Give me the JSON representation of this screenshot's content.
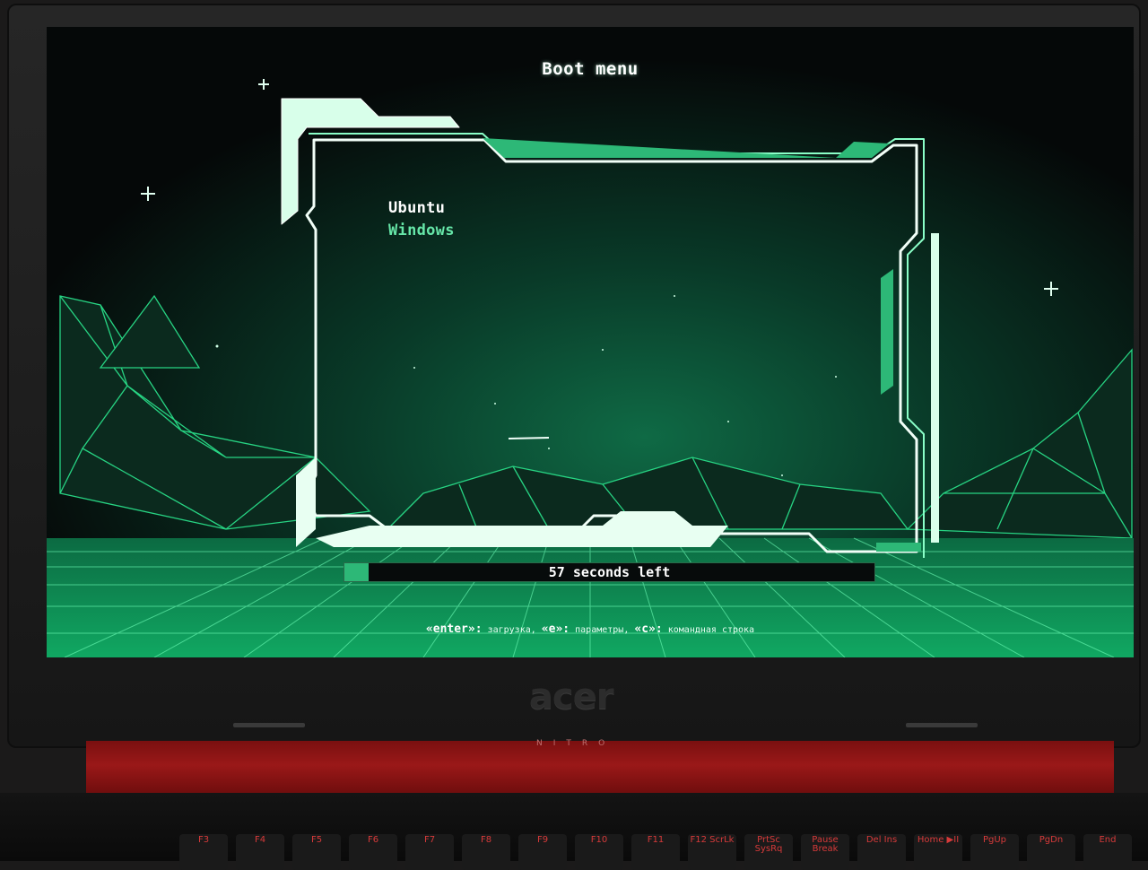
{
  "boot_screen": {
    "title": "Boot menu",
    "menu_items": [
      {
        "label": "Ubuntu",
        "selected": true
      },
      {
        "label": "Windows",
        "selected": false
      }
    ],
    "countdown_text": "57 seconds left",
    "hint": {
      "enter_key": "«enter»:",
      "enter_action": "загрузка,",
      "e_key": "«e»:",
      "e_action": "параметры,",
      "c_key": "«c»:",
      "c_action": "командная строка"
    },
    "theme_colors": {
      "accent": "#2db877",
      "frame": "#e9fff2",
      "grid": "#20c07a",
      "selected_text": "#ffffff",
      "unselected_text": "#66e6a8"
    }
  },
  "laptop": {
    "brand": "acer",
    "base_label": "NITRO",
    "keys": [
      "F3",
      "F4",
      "F5",
      "F6",
      "F7",
      "F8",
      "F9",
      "F10",
      "F11",
      "F12\nScrLk",
      "PrtSc\nSysRq",
      "Pause\nBreak",
      "Del\nIns",
      "Home\n▶II",
      "PgUp",
      "PgDn",
      "End"
    ]
  }
}
